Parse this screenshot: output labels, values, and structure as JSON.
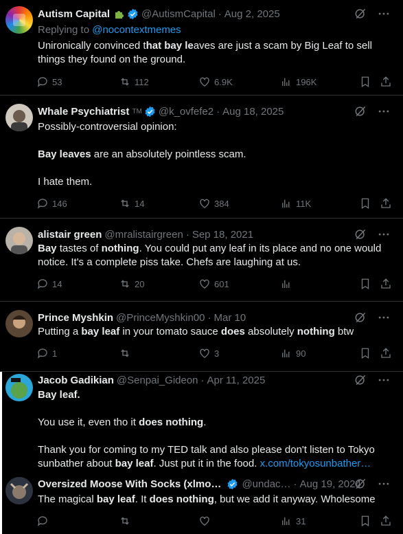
{
  "tweets": [
    {
      "name": "Autism Capital",
      "handle": "@AutismCapital",
      "date": "Aug 2, 2025",
      "replying_prefix": "Replying to",
      "replying_handle": "@nocontextmemes",
      "text": [
        {
          "t": "Unironically convinced t",
          "b": false
        },
        {
          "t": "hat bay le",
          "b": true
        },
        {
          "t": "aves are just a scam by Big Leaf to sell things they found on the ground.",
          "b": false
        }
      ],
      "replies": "53",
      "reposts": "112",
      "likes": "6.9K",
      "views": "196K"
    },
    {
      "name": "Whale Psychiatrist",
      "suffix": "TM",
      "handle": "@k_ovfefe2",
      "date": "Aug 18, 2025",
      "lines": [
        [
          {
            "t": "Possibly-controversial opinion:",
            "b": false
          }
        ],
        [],
        [
          {
            "t": "Bay leaves",
            "b": true
          },
          {
            "t": " are an absolutely pointless scam.",
            "b": false
          }
        ],
        [],
        [
          {
            "t": "I hate them.",
            "b": false
          }
        ]
      ],
      "replies": "146",
      "reposts": "14",
      "likes": "384",
      "views": "11K"
    },
    {
      "name": "alistair green",
      "handle": "@mralistairgreen",
      "date": "Sep 18, 2021",
      "text": [
        {
          "t": "Bay",
          "b": true
        },
        {
          "t": " tastes of ",
          "b": false
        },
        {
          "t": "nothing",
          "b": true
        },
        {
          "t": ". You could put any leaf in its place and no one would notice. It's a complete piss take. Chefs are laughing at us.",
          "b": false
        }
      ],
      "replies": "14",
      "reposts": "20",
      "likes": "601",
      "views": ""
    },
    {
      "name": "Prince Myshkin",
      "handle": "@PrinceMyshkin00",
      "date": "Mar 10",
      "text": [
        {
          "t": "Putting a ",
          "b": false
        },
        {
          "t": "bay leaf",
          "b": true
        },
        {
          "t": " in your tomato sauce ",
          "b": false
        },
        {
          "t": "does",
          "b": true
        },
        {
          "t": " absolutely ",
          "b": false
        },
        {
          "t": "nothing",
          "b": true
        },
        {
          "t": " btw",
          "b": false
        }
      ],
      "replies": "1",
      "reposts": "",
      "likes": "3",
      "views": "90"
    },
    {
      "name": "Jacob Gadikian",
      "handle": "@Senpai_Gideon",
      "date": "Apr 11, 2025",
      "lines": [
        [
          {
            "t": "Bay leaf.",
            "b": true
          }
        ],
        [],
        [
          {
            "t": "You use it, even tho it ",
            "b": false
          },
          {
            "t": "does nothing",
            "b": true
          },
          {
            "t": ".",
            "b": false
          }
        ],
        [],
        [
          {
            "t": "Thank you for coming to my TED talk and also please don't listen to Tokyo",
            "b": false
          }
        ],
        [
          {
            "t": "sunbather about ",
            "b": false
          },
          {
            "t": "bay leaf",
            "b": true
          },
          {
            "t": ". Just put it in the food. ",
            "b": false
          },
          {
            "t": "x.com/tokyosunbather…",
            "b": false,
            "link": true
          }
        ]
      ]
    },
    {
      "name": "Oversized Moose With Socks (xlmo…",
      "handle": "@undac…",
      "date": "Aug 19, 2024",
      "text": [
        {
          "t": "The magical ",
          "b": false
        },
        {
          "t": "bay leaf",
          "b": true
        },
        {
          "t": ". It ",
          "b": false
        },
        {
          "t": "does nothing",
          "b": true
        },
        {
          "t": ", but we add it anyway. Wholesome",
          "b": false
        }
      ],
      "replies": "",
      "reposts": "",
      "likes": "",
      "views": "31"
    }
  ],
  "colors": {
    "accent": "#1d9bf0",
    "muted": "#71767b",
    "text": "#e7e9ea",
    "border": "#2f3336"
  }
}
